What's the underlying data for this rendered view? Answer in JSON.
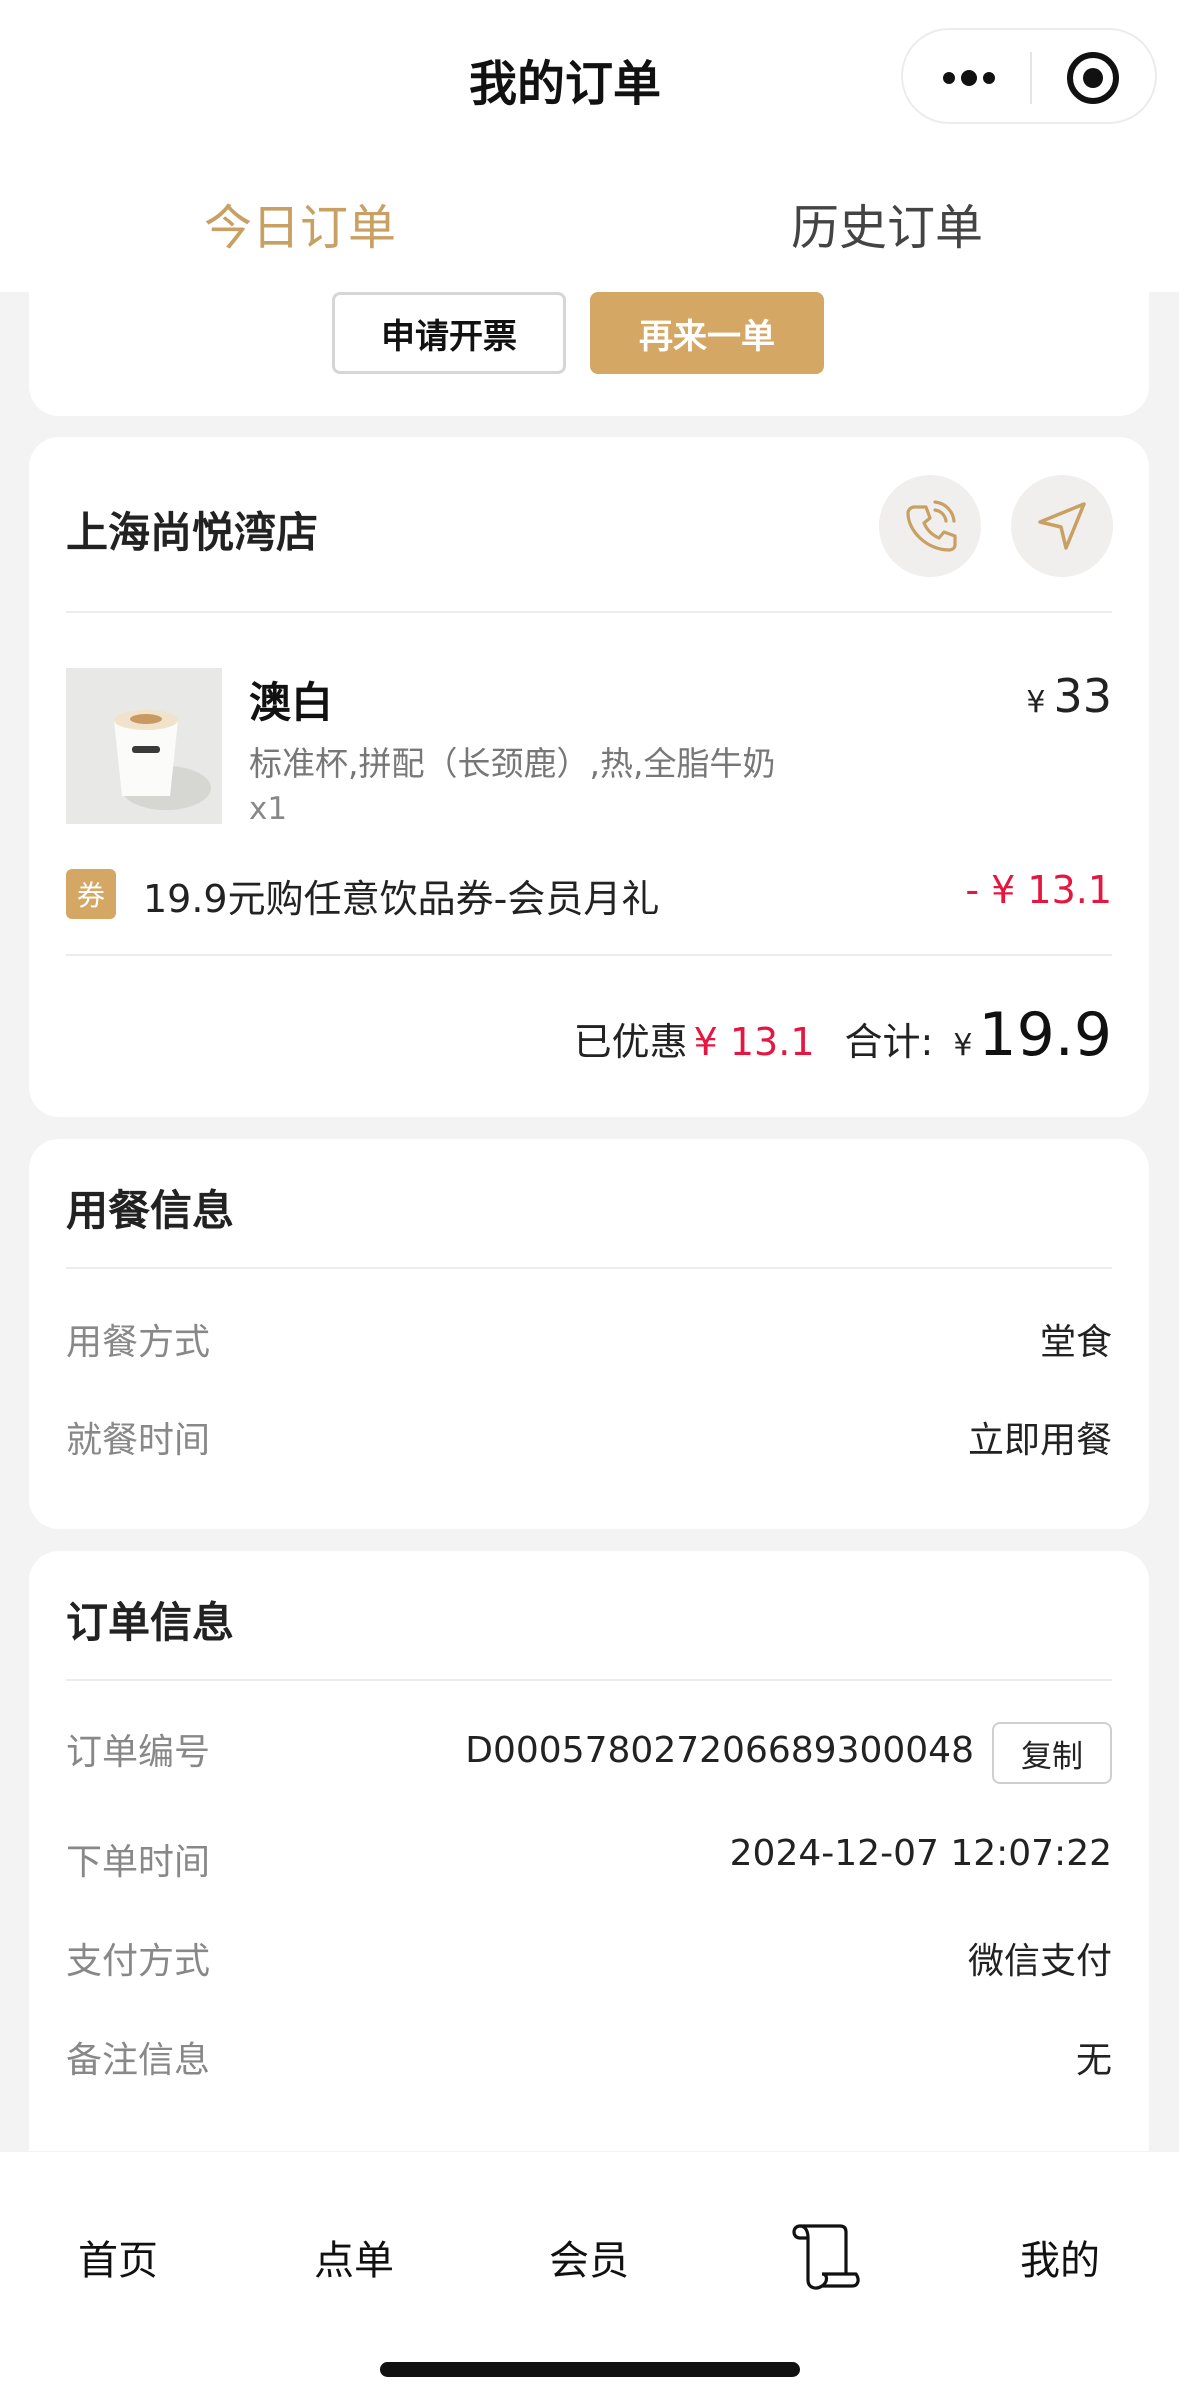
{
  "header": {
    "title": "我的订单",
    "more_icon": "more-dots-icon",
    "close_icon": "target-icon"
  },
  "tabs": [
    {
      "label": "今日订单",
      "active": true
    },
    {
      "label": "历史订单",
      "active": false
    }
  ],
  "actions": {
    "invoice_label": "申请开票",
    "reorder_label": "再来一单"
  },
  "store": {
    "name": "上海尚悦湾店",
    "phone_icon": "phone-icon",
    "navigate_icon": "navigate-icon"
  },
  "product": {
    "name": "澳白",
    "spec": "标准杯,拼配（长颈鹿）,热,全脂牛奶",
    "qty": "x1",
    "price_symbol": "¥",
    "price": "33"
  },
  "coupon": {
    "badge": "券",
    "name": "19.9元购任意饮品券-会员月礼",
    "amount": "- ¥ 13.1"
  },
  "totals": {
    "discount_label": "已优惠",
    "discount_value": "¥ 13.1",
    "sum_label": "合计:",
    "sum_symbol": "¥",
    "sum_value": "19.9"
  },
  "dining": {
    "title": "用餐信息",
    "rows": [
      {
        "label": "用餐方式",
        "value": "堂食"
      },
      {
        "label": "就餐时间",
        "value": "立即用餐"
      }
    ]
  },
  "order": {
    "title": "订单信息",
    "number_label": "订单编号",
    "number_value": "D000578027206689300048",
    "copy_label": "复制",
    "time_label": "下单时间",
    "time_value": "2024-12-07 12:07:22",
    "pay_label": "支付方式",
    "pay_value": "微信支付",
    "note_label": "备注信息",
    "note_value": "无"
  },
  "tabbar": {
    "home": "首页",
    "order": "点单",
    "member": "会员",
    "scroll_icon": "scroll-icon",
    "mine": "我的"
  },
  "colors": {
    "accent": "#c9a063",
    "gold_button": "#d4a765",
    "discount_red": "#e5163f"
  }
}
